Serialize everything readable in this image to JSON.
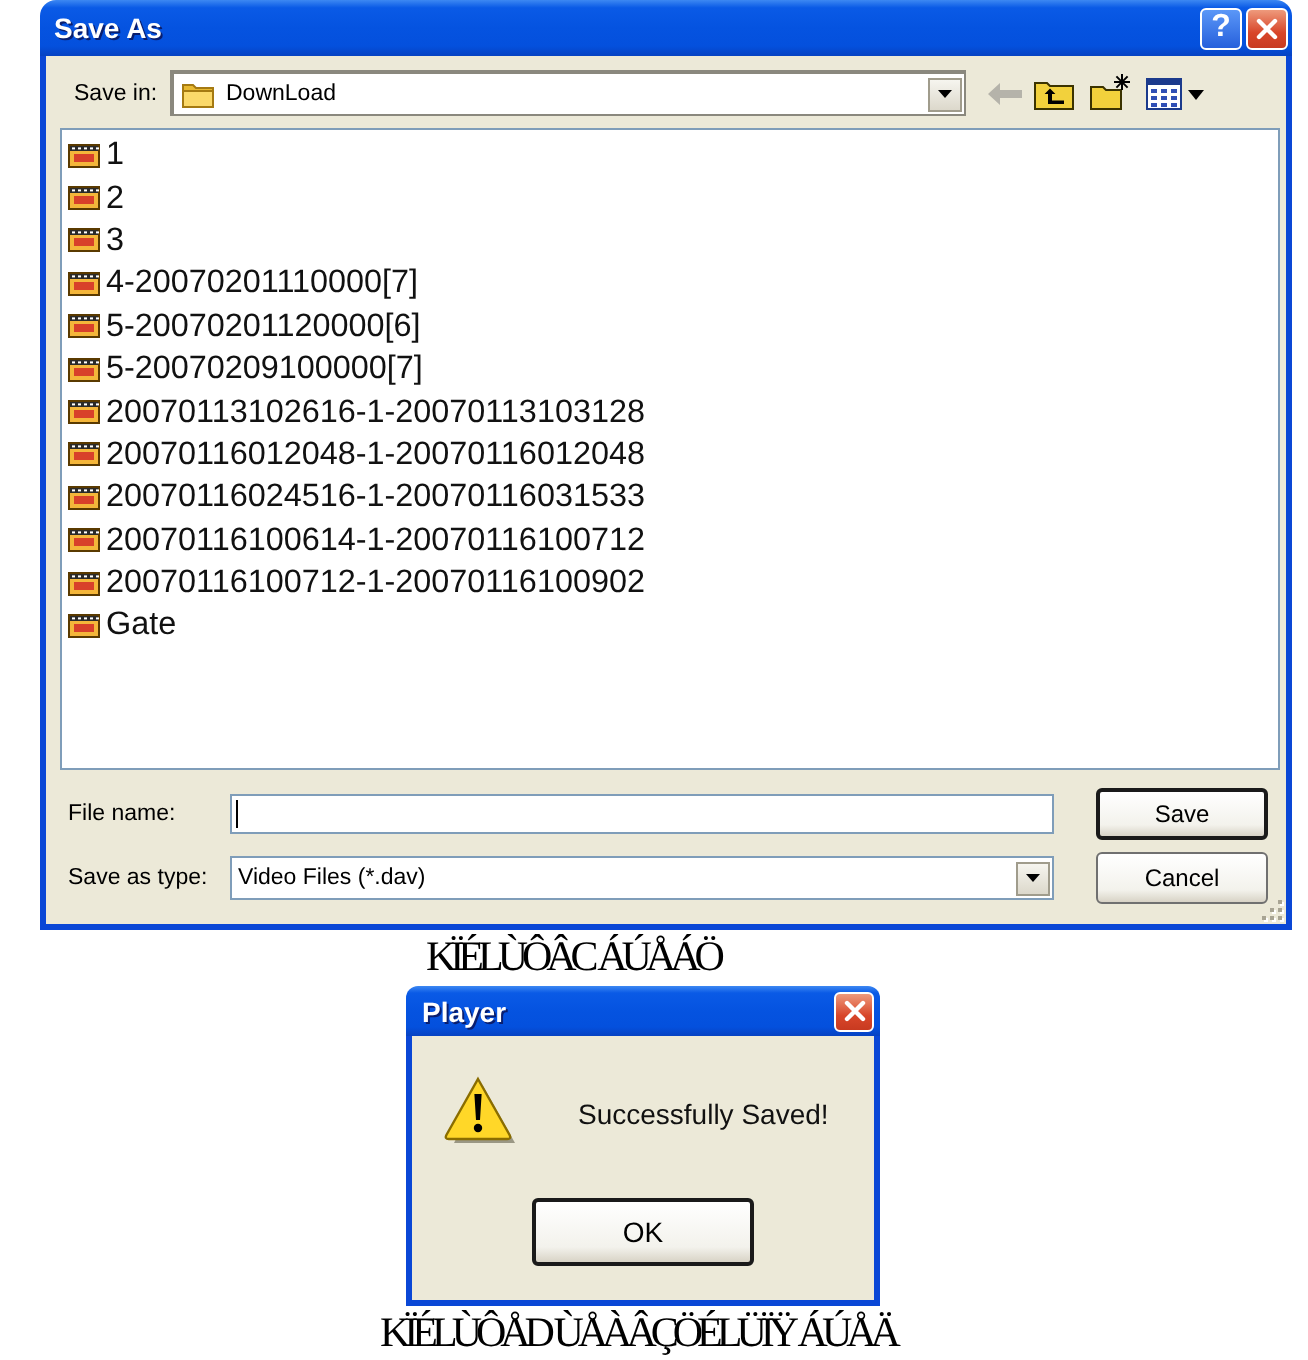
{
  "save_dialog": {
    "title": "Save As",
    "help_button": "?",
    "save_in": {
      "label": "Save in:",
      "value": "DownLoad"
    },
    "toolbar": [
      {
        "kind": "back",
        "disabled": true
      },
      {
        "kind": "up_folder",
        "disabled": false
      },
      {
        "kind": "new_folder",
        "disabled": false
      },
      {
        "kind": "views_menu",
        "disabled": false
      }
    ],
    "files": [
      {
        "name": "1",
        "selected": false
      },
      {
        "name": "2",
        "selected": false
      },
      {
        "name": "3",
        "selected": false
      },
      {
        "name": "4-20070201110000[7]",
        "selected": false
      },
      {
        "name": "5-20070201120000[6]",
        "selected": false
      },
      {
        "name": "5-20070209100000[7]",
        "selected": false
      },
      {
        "name": "20070113102616-1-20070113103128",
        "selected": false
      },
      {
        "name": "20070116012048-1-20070116012048",
        "selected": false
      },
      {
        "name": "20070116024516-1-20070116031533",
        "selected": false
      },
      {
        "name": "20070116100614-1-20070116100712",
        "selected": false
      },
      {
        "name": "20070116100712-1-20070116100902",
        "selected": false
      },
      {
        "name": "Gate",
        "selected": false
      }
    ],
    "file_name": {
      "label": "File name:",
      "focused": true
    },
    "save_as_type": {
      "label": "Save as type:",
      "value": "Video Files (*.dav)"
    },
    "buttons": [
      {
        "label": "Save",
        "default": true
      },
      {
        "label": "Cancel",
        "default": false
      }
    ]
  },
  "caption_1": "KÏÉLÙÔÂC ÁÚÅÁÖ",
  "message_box": {
    "title": "Player",
    "kind": "warning",
    "message": "Successfully Saved!",
    "buttons": [
      {
        "label": "OK",
        "default": true
      }
    ]
  },
  "caption_2": "KÏÉLÙÔÅD ÙÅÀÂÇÖÉLÜÏŸ ÁÚÅÄ"
}
